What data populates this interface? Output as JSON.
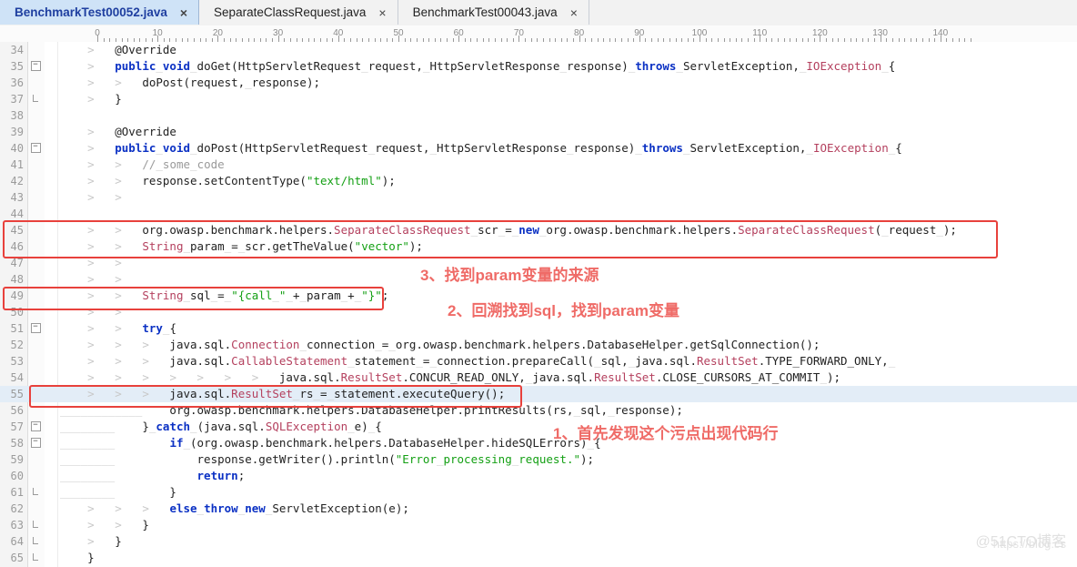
{
  "window": {
    "title": "BenchmarkTest00052.java"
  },
  "tabs": [
    {
      "label": "BenchmarkTest00052.java",
      "active": true,
      "close": "×"
    },
    {
      "label": "SeparateClassRequest.java",
      "active": false,
      "close": "×"
    },
    {
      "label": "BenchmarkTest00043.java",
      "active": false,
      "close": "×"
    }
  ],
  "ruler": {
    "labels": [
      0,
      10,
      20,
      30,
      40,
      50,
      60,
      70,
      80,
      90,
      100,
      110,
      120,
      130,
      140
    ]
  },
  "editor": {
    "current_line": 55,
    "first_line": 34,
    "last_line": 65,
    "lines": [
      {
        "n": 34,
        "fold": "",
        "text": "@Override"
      },
      {
        "n": 35,
        "fold": "-",
        "text": "public void doGet(HttpServletRequest request, HttpServletResponse response) throws ServletException, IOException {"
      },
      {
        "n": 36,
        "fold": "",
        "text": "doPost(request, response);"
      },
      {
        "n": 37,
        "fold": "|",
        "text": "}"
      },
      {
        "n": 38,
        "fold": "",
        "text": ""
      },
      {
        "n": 39,
        "fold": "",
        "text": "@Override"
      },
      {
        "n": 40,
        "fold": "-",
        "text": "public void doPost(HttpServletRequest request, HttpServletResponse response) throws ServletException, IOException {"
      },
      {
        "n": 41,
        "fold": "",
        "text": "// some code"
      },
      {
        "n": 42,
        "fold": "",
        "text": "response.setContentType(\"text/html\");"
      },
      {
        "n": 43,
        "fold": "",
        "text": ""
      },
      {
        "n": 44,
        "fold": "",
        "text": ""
      },
      {
        "n": 45,
        "fold": "",
        "text": "org.owasp.benchmark.helpers.SeparateClassRequest scr = new org.owasp.benchmark.helpers.SeparateClassRequest( request );"
      },
      {
        "n": 46,
        "fold": "",
        "text": "String param = scr.getTheValue(\"vector\");"
      },
      {
        "n": 47,
        "fold": "",
        "text": ""
      },
      {
        "n": 48,
        "fold": "",
        "text": ""
      },
      {
        "n": 49,
        "fold": "",
        "text": "String sql = \"{call \" + param + \"}\";"
      },
      {
        "n": 50,
        "fold": "",
        "text": ""
      },
      {
        "n": 51,
        "fold": "-",
        "text": "try {"
      },
      {
        "n": 52,
        "fold": "",
        "text": "java.sql.Connection connection = org.owasp.benchmark.helpers.DatabaseHelper.getSqlConnection();"
      },
      {
        "n": 53,
        "fold": "",
        "text": "java.sql.CallableStatement statement = connection.prepareCall( sql, java.sql.ResultSet.TYPE_FORWARD_ONLY, "
      },
      {
        "n": 54,
        "fold": "",
        "text": "java.sql.ResultSet.CONCUR_READ_ONLY, java.sql.ResultSet.CLOSE_CURSORS_AT_COMMIT );"
      },
      {
        "n": 55,
        "fold": "",
        "text": "java.sql.ResultSet rs = statement.executeQuery();"
      },
      {
        "n": 56,
        "fold": "",
        "text": "org.owasp.benchmark.helpers.DatabaseHelper.printResults(rs, sql, response);"
      },
      {
        "n": 57,
        "fold": "-",
        "text": "} catch (java.sql.SQLException e) {"
      },
      {
        "n": 58,
        "fold": "-",
        "text": "if (org.owasp.benchmark.helpers.DatabaseHelper.hideSQLErrors) {"
      },
      {
        "n": 59,
        "fold": "",
        "text": "response.getWriter().println(\"Error processing request.\");"
      },
      {
        "n": 60,
        "fold": "",
        "text": "return;"
      },
      {
        "n": 61,
        "fold": "|",
        "text": "}"
      },
      {
        "n": 62,
        "fold": "",
        "text": "else throw new ServletException(e);"
      },
      {
        "n": 63,
        "fold": "|",
        "text": "}"
      },
      {
        "n": 64,
        "fold": "|",
        "text": "}"
      },
      {
        "n": 65,
        "fold": "|",
        "text": "}"
      }
    ]
  },
  "annotations": [
    {
      "id": "note1",
      "text": "1、首先发现这个污点出现代码行"
    },
    {
      "id": "note2",
      "text": "2、回溯找到sql，找到param变量"
    },
    {
      "id": "note3",
      "text": "3、找到param变量的来源"
    }
  ],
  "highlight_boxes": [
    {
      "name": "box-source-lines-45-46"
    },
    {
      "name": "box-sql-line-49"
    },
    {
      "name": "box-sink-line-55"
    }
  ],
  "watermark": {
    "url": "https://blog.cs",
    "brand": "@51CTO博客"
  },
  "colors": {
    "accent_red": "#e8413c",
    "note_red": "#ef6b67",
    "keyword_blue": "#0b31c4",
    "type_red": "#b4405e",
    "string_green": "#14a014",
    "active_tab_bg": "#cfe3f7",
    "current_line_bg": "#e3edf7"
  }
}
